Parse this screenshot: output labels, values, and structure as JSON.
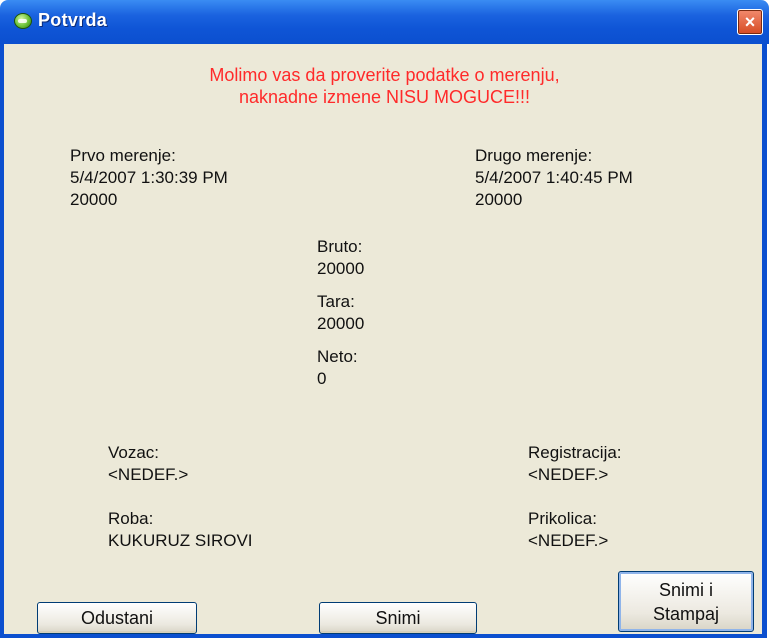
{
  "window": {
    "title": "Potvrda",
    "close_icon": "×"
  },
  "message": {
    "line1": "Molimo vas da proverite podatke o merenju,",
    "line2": "naknadne izmene NISU MOGUCE!!!",
    "color": "#ff2a2a"
  },
  "first_measure": {
    "label": "Prvo merenje:",
    "datetime": "5/4/2007 1:30:39 PM",
    "value": "20000"
  },
  "second_measure": {
    "label": "Drugo merenje:",
    "datetime": "5/4/2007 1:40:45 PM",
    "value": "20000"
  },
  "bruto": {
    "label": "Bruto:",
    "value": "20000"
  },
  "tara": {
    "label": "Tara:",
    "value": "20000"
  },
  "neto": {
    "label": "Neto:",
    "value": "0"
  },
  "driver": {
    "label": "Vozac:",
    "value": "<NEDEF.>"
  },
  "registration": {
    "label": "Registracija:",
    "value": "<NEDEF.>"
  },
  "goods": {
    "label": "Roba:",
    "value": "KUKURUZ SIROVI"
  },
  "trailer": {
    "label": "Prikolica:",
    "value": "<NEDEF.>"
  },
  "buttons": {
    "cancel": "Odustani",
    "save": "Snimi",
    "save_print_line1": "Snimi i",
    "save_print_line2": "Stampaj"
  }
}
